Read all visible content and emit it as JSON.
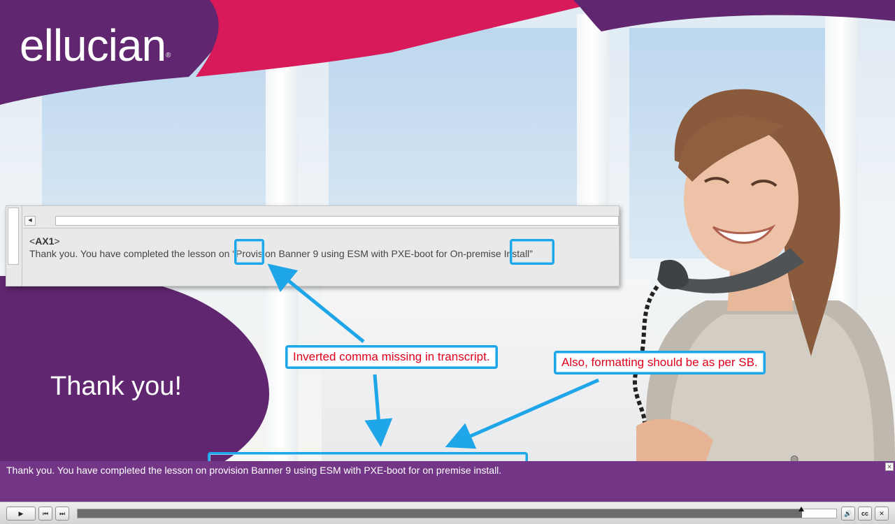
{
  "brand": {
    "name": "ellucian",
    "mark": "®",
    "purple": "#60266f",
    "magenta": "#d8195a"
  },
  "slide": {
    "heading": "Thank you!"
  },
  "transcript": {
    "id_open": "<",
    "id": "AX1",
    "id_close": ">",
    "text": "Thank you. You have completed the lesson on “Provision Banner 9 using ESM with PXE-boot for On-premise Install”"
  },
  "annotations": {
    "note_1": "Inverted comma missing in transcript.",
    "note_2": "Also, formatting should be as per SB.",
    "color": "#1fa6e8",
    "text_color": "#e0001b"
  },
  "caption": {
    "text": "Thank you. You have completed the lesson on provision Banner 9 using ESM with PXE-boot for on premise install.",
    "close_icon": "✕"
  },
  "player": {
    "play_icon": "▶",
    "rewind_icon": "⏮",
    "forward_icon": "⏭",
    "volume_icon": "🔊",
    "cc_label": "cc",
    "close_icon": "✕",
    "progress": 0.955
  }
}
